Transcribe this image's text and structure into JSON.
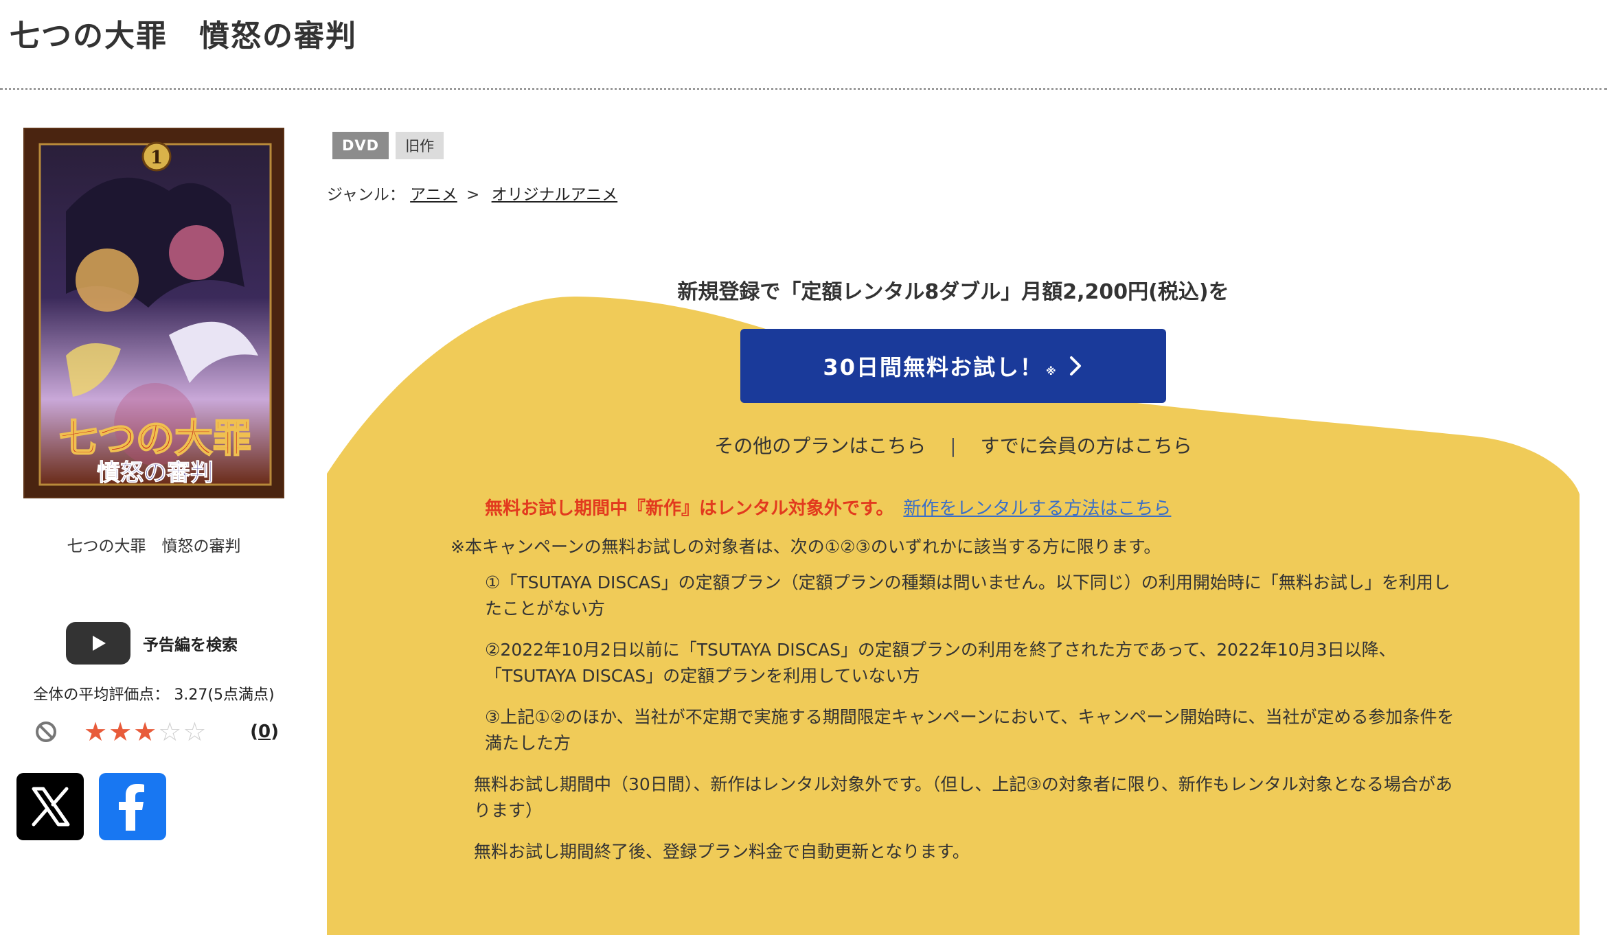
{
  "page": {
    "title": "七つの大罪　憤怒の審判"
  },
  "product": {
    "jacket_alt": "七つの大罪 憤怒の審判 ジャケット画像",
    "jacket_logo_text": "七つの大罪",
    "jacket_sub_text": "憤怒の審判",
    "jacket_volume": "1",
    "title": "七つの大罪　憤怒の審判",
    "trailer_label": "予告編を検索",
    "rating_text": "全体の平均評価点：  3.27(5点満点)",
    "rating_value": 3.27,
    "rating_max": 5,
    "review_count": "0",
    "tags": [
      "DVD",
      "旧作"
    ],
    "genre_label": "ジャンル：",
    "genre_path": [
      "アニメ",
      "オリジナルアニメ"
    ],
    "genre_separator": ">"
  },
  "share": {
    "x_icon": "x-logo-icon",
    "facebook_icon": "facebook-logo-icon"
  },
  "campaign": {
    "lead": "新規登録で「定額レンタル8ダブル」月額2,200円(税込)を",
    "cta_label": "30日間無料お試し！",
    "cta_note_mark": "※",
    "other_plans_link": "その他のプランはこちら",
    "link_separator": "|",
    "member_link": "すでに会員の方はこちら",
    "warning": "無料お試し期間中『新作』はレンタル対象外です。",
    "warning_link": "新作をレンタルする方法はこちら",
    "notes_intro": "※本キャンペーンの無料お試しの対象者は、次の①②③のいずれかに該当する方に限ります。",
    "conditions": [
      "①「TSUTAYA DISCAS」の定額プラン（定額プランの種類は問いません。以下同じ）の利用開始時に「無料お試し」を利用したことがない方",
      "②2022年10月2日以前に「TSUTAYA DISCAS」の定額プランの利用を終了された方であって、2022年10月3日以降、「TSUTAYA DISCAS」の定額プランを利用していない方",
      "③上記①②のほか、当社が不定期で実施する期間限定キャンペーンにおいて、キャンペーン開始時に、当社が定める参加条件を満たした方"
    ],
    "note_new_release": "無料お試し期間中（30日間）、新作はレンタル対象外です。（但し、上記③の対象者に限り、新作もレンタル対象となる場合があります）",
    "note_auto_renew": "無料お試し期間終了後、登録プラン料金で自動更新となります。"
  },
  "colors": {
    "campaign_bg": "#f0cb58",
    "cta_bg": "#1a3a9a",
    "warning_red": "#e23a1e",
    "link_blue": "#3a6fc8",
    "star_on": "#e85b3a"
  }
}
